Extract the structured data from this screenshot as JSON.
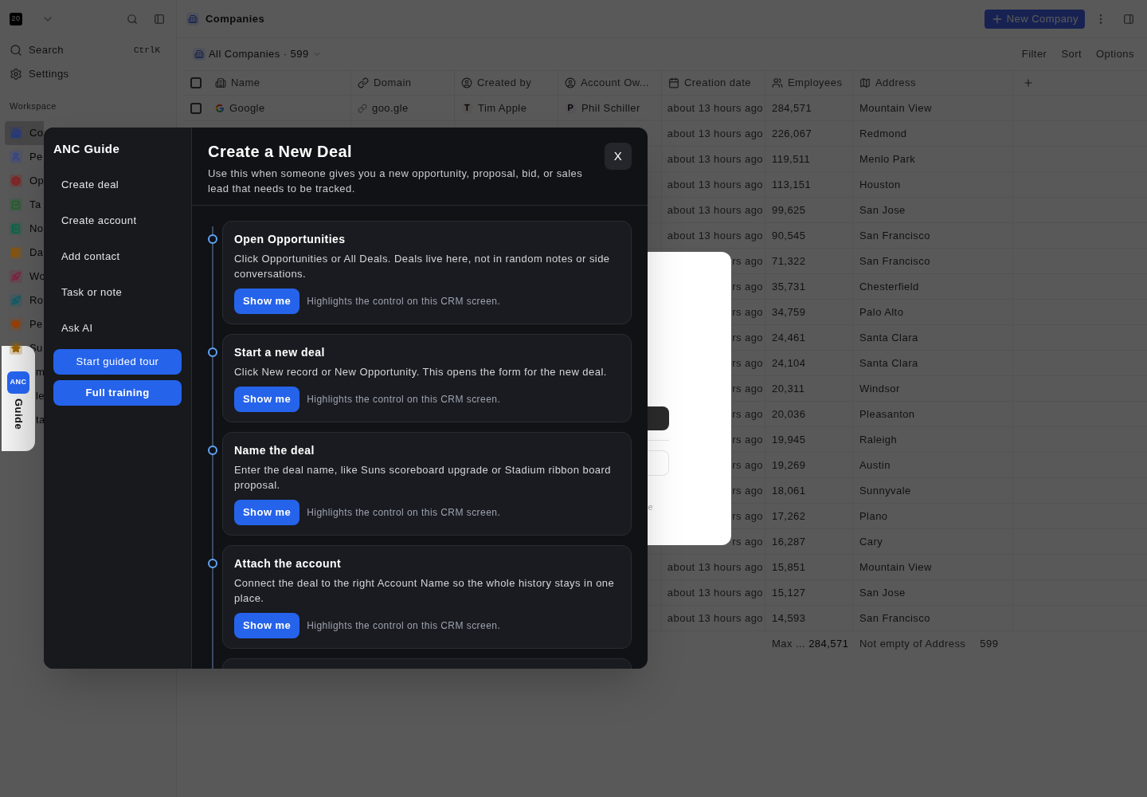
{
  "app": {
    "logo": "20"
  },
  "sidebar": {
    "search": {
      "label": "Search",
      "shortcut": "CtrlK"
    },
    "settings": "Settings",
    "section": "Workspace",
    "items": [
      {
        "label": "Co",
        "color": "#233783",
        "kind": "icon",
        "selected": true
      },
      {
        "label": "Pe",
        "color": "#2e4293",
        "kind": "icon",
        "selected": false
      },
      {
        "label": "Op",
        "color": "#861d1d",
        "kind": "icon",
        "selected": false
      },
      {
        "label": "Ta",
        "color": "#1c5f29",
        "kind": "icon",
        "selected": false
      },
      {
        "label": "No",
        "color": "#076448",
        "kind": "icon",
        "selected": false
      },
      {
        "label": "Da",
        "color": "#905400",
        "kind": "icon",
        "selected": false
      },
      {
        "label": "Wo",
        "color": "#801f41",
        "kind": "icon",
        "selected": false
      },
      {
        "label": "Ro",
        "color": "#0a5b68",
        "kind": "icon",
        "selected": false
      },
      {
        "label": "Pe",
        "color": "#943e04",
        "kind": "icon",
        "selected": false
      },
      {
        "label": "Su",
        "color": "#935f00",
        "kind": "icon",
        "selected": false
      },
      {
        "label": "m",
        "kind": "covered",
        "selected": false
      },
      {
        "label": "le",
        "kind": "covered",
        "selected": false
      },
      {
        "label": "ta",
        "kind": "covered",
        "selected": false
      }
    ]
  },
  "header": {
    "title": "Companies",
    "new_button": "New Company"
  },
  "view": {
    "name": "All Companies · 599",
    "actions": [
      "Filter",
      "Sort",
      "Options"
    ]
  },
  "table": {
    "header_checked": false,
    "columns": [
      "Name",
      "Domain",
      "Created by",
      "Account Ow...",
      "Creation date",
      "Employees",
      "Address"
    ],
    "rows": [
      {
        "checked": false,
        "name": "Google",
        "domain": "goo.gle",
        "created_by": {
          "initial": "T",
          "name": "Tim Apple"
        },
        "account_owner": {
          "initial": "P",
          "name": "Phil Schiller"
        },
        "creation_date": "about 13 hours ago",
        "employees": "284,571",
        "address": "Mountain View"
      },
      {
        "creation_date": "about 13 hours ago",
        "employees": "226,067",
        "address": "Redmond"
      },
      {
        "creation_date": "about 13 hours ago",
        "employees": "119,511",
        "address": "Menlo Park"
      },
      {
        "creation_date": "about 13 hours ago",
        "employees": "113,151",
        "address": "Houston"
      },
      {
        "creation_date": "about 13 hours ago",
        "employees": "99,625",
        "address": "San Jose"
      },
      {
        "creation_date": "about 13 hours ago",
        "employees": "90,545",
        "address": "San Francisco"
      },
      {
        "creation_date": "rs ago",
        "employees": "71,322",
        "address": "San Francisco"
      },
      {
        "creation_date": "rs ago",
        "employees": "35,731",
        "address": "Chesterfield"
      },
      {
        "creation_date": "rs ago",
        "employees": "34,759",
        "address": "Palo Alto"
      },
      {
        "creation_date": "rs ago",
        "employees": "24,461",
        "address": "Santa Clara"
      },
      {
        "creation_date": "rs ago",
        "employees": "24,104",
        "address": "Santa Clara"
      },
      {
        "creation_date": "rs ago",
        "employees": "20,311",
        "address": "Windsor"
      },
      {
        "creation_date": "rs ago",
        "employees": "20,036",
        "address": "Pleasanton"
      },
      {
        "creation_date": "rs ago",
        "employees": "19,945",
        "address": "Raleigh"
      },
      {
        "creation_date": "rs ago",
        "employees": "19,269",
        "address": "Austin"
      },
      {
        "creation_date": "rs ago",
        "employees": "18,061",
        "address": "Sunnyvale"
      },
      {
        "creation_date": "rs ago",
        "employees": "17,262",
        "address": "Plano"
      },
      {
        "creation_date": "rs ago",
        "employees": "16,287",
        "address": "Cary"
      },
      {
        "creation_date": "about 13 hours ago",
        "employees": "15,851",
        "address": "Mountain View"
      },
      {
        "creation_date": "about 13 hours ago",
        "employees": "15,127",
        "address": "San Jose"
      },
      {
        "creation_date": "about 13 hours ago",
        "employees": "14,593",
        "address": "San Francisco"
      }
    ],
    "footer": {
      "employees_label": "Max ...",
      "employees_value": "284,571",
      "address_label": "Not empty of Address",
      "address_value": "599"
    }
  },
  "background_dialog": {
    "hint": "e"
  },
  "guide_tab": {
    "badge": "ANC",
    "label": "Guide"
  },
  "guide": {
    "title": "ANC Guide",
    "nav": [
      "Create deal",
      "Create account",
      "Add contact",
      "Task or note",
      "Ask AI"
    ],
    "actions": [
      {
        "label": "Start guided tour",
        "kind": "tour"
      },
      {
        "label": "Full training",
        "kind": "training"
      }
    ],
    "panel": {
      "title": "Create a New Deal",
      "description": "Use this when someone gives you a new opportunity, proposal, bid, or sales lead that needs to be tracked.",
      "close": "X",
      "steps": [
        {
          "title": "Open Opportunities",
          "body": "Click Opportunities or All Deals. Deals live here, not in random notes or side conversations.",
          "button": "Show me",
          "hint": "Highlights the control on this CRM screen."
        },
        {
          "title": "Start a new deal",
          "body": "Click New record or New Opportunity. This opens the form for the new deal.",
          "button": "Show me",
          "hint": "Highlights the control on this CRM screen."
        },
        {
          "title": "Name the deal",
          "body": "Enter the deal name, like Suns scoreboard upgrade or Stadium ribbon board proposal.",
          "button": "Show me",
          "hint": "Highlights the control on this CRM screen."
        },
        {
          "title": "Attach the account",
          "body": "Connect the deal to the right Account Name so the whole history stays in one place.",
          "button": "Show me",
          "hint": "Highlights the control on this CRM screen."
        }
      ],
      "next_step_peek": true
    }
  }
}
